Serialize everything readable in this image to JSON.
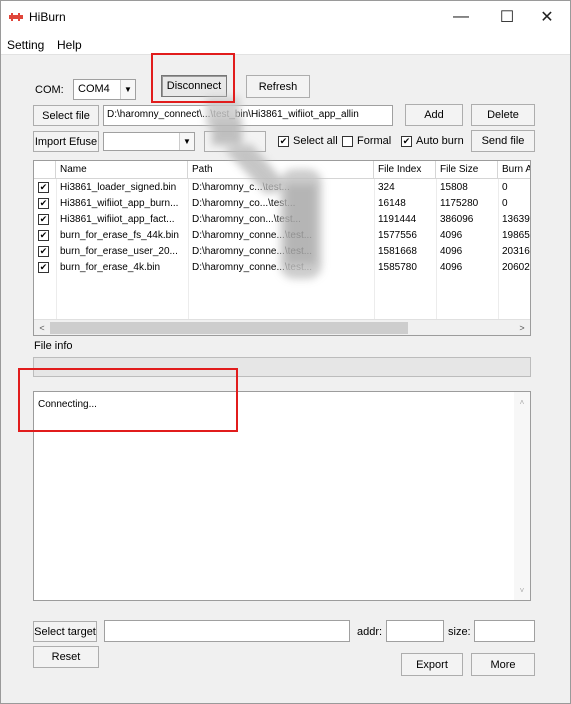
{
  "window": {
    "title": "HiBurn",
    "minimize_glyph": "—",
    "maximize_glyph": "☐",
    "close_glyph": "✕",
    "icon": "app-logo-icon"
  },
  "menu": {
    "items": [
      "Setting",
      "Help"
    ]
  },
  "com": {
    "label": "COM:",
    "selected": "COM4",
    "disconnect_label": "Disconnect",
    "refresh_label": "Refresh"
  },
  "file_row": {
    "select_file_label": "Select file",
    "path_value": "D:\\haromny_connect\\...\\test_bin\\Hi3861_wifiiot_app_allin",
    "add_label": "Add",
    "delete_label": "Delete"
  },
  "efuse_row": {
    "import_label": "Import Efuse",
    "select_all_label": "Select all",
    "formal_label": "Formal",
    "auto_burn_label": "Auto burn",
    "send_file_label": "Send file",
    "select_all_checked": true,
    "formal_checked": false,
    "auto_burn_checked": true
  },
  "table": {
    "columns": [
      "Name",
      "Path",
      "File Index",
      "File Size",
      "Burn A"
    ],
    "rows": [
      {
        "checked": true,
        "name": "Hi3861_loader_signed.bin",
        "path": "D:\\haromny_c...\\test...",
        "index": "324",
        "size": "15808",
        "burn": "0"
      },
      {
        "checked": true,
        "name": "Hi3861_wifiiot_app_burn...",
        "path": "D:\\haromny_co...\\test...",
        "index": "16148",
        "size": "1175280",
        "burn": "0"
      },
      {
        "checked": true,
        "name": "Hi3861_wifiiot_app_fact...",
        "path": "D:\\haromny_con...\\test...",
        "index": "1191444",
        "size": "386096",
        "burn": "13639"
      },
      {
        "checked": true,
        "name": "burn_for_erase_fs_44k.bin",
        "path": "D:\\haromny_conne...\\test...",
        "index": "1577556",
        "size": "4096",
        "burn": "19865"
      },
      {
        "checked": true,
        "name": "burn_for_erase_user_20...",
        "path": "D:\\haromny_conne...\\test...",
        "index": "1581668",
        "size": "4096",
        "burn": "20316"
      },
      {
        "checked": true,
        "name": "burn_for_erase_4k.bin",
        "path": "D:\\haromny_conne...\\test...",
        "index": "1585780",
        "size": "4096",
        "burn": "20602"
      }
    ],
    "scroll_left": "<",
    "scroll_right": ">"
  },
  "file_info": {
    "label": "File info"
  },
  "log": {
    "text": "Connecting...",
    "scroll_up": "˄",
    "scroll_down": "˅"
  },
  "bottom": {
    "select_target_label": "Select target",
    "reset_label": "Reset",
    "addr_label": "addr:",
    "size_label": "size:",
    "export_label": "Export",
    "more_label": "More"
  },
  "colors": {
    "highlight_box": "#e11c1c",
    "window_bg": "#f0f0f0"
  }
}
